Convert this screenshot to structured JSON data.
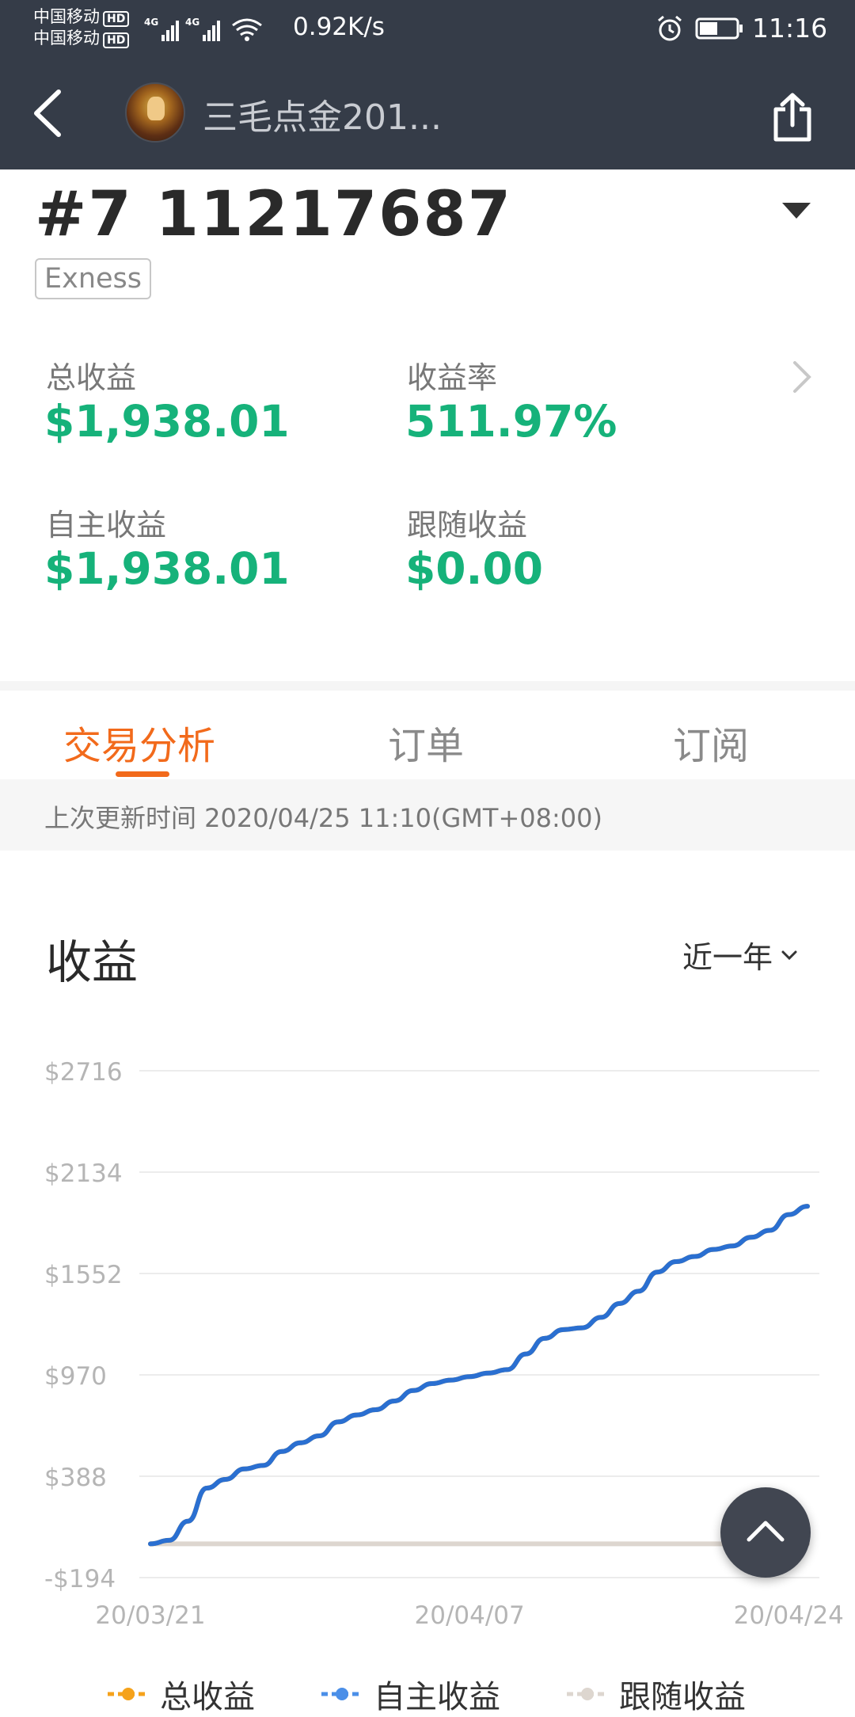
{
  "status_bar": {
    "carrier_1": "中国移动",
    "carrier_2": "中国移动",
    "hd_badge": "HD",
    "net_type": "4G",
    "speed": "0.92K/s",
    "time": "11:16"
  },
  "header": {
    "title": "三毛点金201..."
  },
  "account": {
    "id": "#7 11217687",
    "broker": "Exness"
  },
  "stats": {
    "total_label": "总收益",
    "total_value": "$1,938.01",
    "rate_label": "收益率",
    "rate_value": "511.97%",
    "own_label": "自主收益",
    "own_value": "$1,938.01",
    "follow_label": "跟随收益",
    "follow_value": "$0.00"
  },
  "tabs": [
    {
      "label": "交易分析",
      "active": true
    },
    {
      "label": "订单",
      "active": false
    },
    {
      "label": "订阅",
      "active": false
    }
  ],
  "update_text": "上次更新时间 2020/04/25 11:10(GMT+08:00)",
  "section": {
    "title": "收益",
    "period": "近一年"
  },
  "colors": {
    "accent": "#f26a1b",
    "profit_green": "#16b27a",
    "series_own": "#2a6fd1",
    "series_follow": "#ddd6cf",
    "series_total": "#f5a21b"
  },
  "chart_data": {
    "type": "line",
    "y_ticks": [
      "$2716",
      "$2134",
      "$1552",
      "$970",
      "$388",
      "-$194"
    ],
    "y_tick_values": [
      2716,
      2134,
      1552,
      970,
      388,
      -194
    ],
    "ylim": [
      -194,
      2716
    ],
    "x_ticks": [
      "20/03/21",
      "20/04/07",
      "20/04/24"
    ],
    "x": [
      "2020-03-21",
      "2020-03-22",
      "2020-03-23",
      "2020-03-24",
      "2020-03-25",
      "2020-03-26",
      "2020-03-27",
      "2020-03-28",
      "2020-03-29",
      "2020-03-30",
      "2020-03-31",
      "2020-04-01",
      "2020-04-02",
      "2020-04-03",
      "2020-04-04",
      "2020-04-05",
      "2020-04-06",
      "2020-04-07",
      "2020-04-08",
      "2020-04-09",
      "2020-04-10",
      "2020-04-11",
      "2020-04-12",
      "2020-04-13",
      "2020-04-14",
      "2020-04-15",
      "2020-04-16",
      "2020-04-17",
      "2020-04-18",
      "2020-04-19",
      "2020-04-20",
      "2020-04-21",
      "2020-04-22",
      "2020-04-23",
      "2020-04-24",
      "2020-04-25"
    ],
    "series": [
      {
        "name": "总收益",
        "values": [
          0,
          20,
          130,
          320,
          370,
          430,
          450,
          530,
          580,
          620,
          700,
          740,
          770,
          820,
          880,
          920,
          940,
          960,
          980,
          1000,
          1090,
          1180,
          1230,
          1240,
          1300,
          1380,
          1450,
          1560,
          1620,
          1650,
          1690,
          1710,
          1760,
          1800,
          1890,
          1938
        ]
      },
      {
        "name": "自主收益",
        "values": [
          0,
          20,
          130,
          320,
          370,
          430,
          450,
          530,
          580,
          620,
          700,
          740,
          770,
          820,
          880,
          920,
          940,
          960,
          980,
          1000,
          1090,
          1180,
          1230,
          1240,
          1300,
          1380,
          1450,
          1560,
          1620,
          1650,
          1690,
          1710,
          1760,
          1800,
          1890,
          1938
        ]
      },
      {
        "name": "跟随收益",
        "values": [
          0,
          0,
          0,
          0,
          0,
          0,
          0,
          0,
          0,
          0,
          0,
          0,
          0,
          0,
          0,
          0,
          0,
          0,
          0,
          0,
          0,
          0,
          0,
          0,
          0,
          0,
          0,
          0,
          0,
          0,
          0,
          0,
          0,
          0,
          0,
          0
        ]
      }
    ],
    "legend": [
      "总收益",
      "自主收益",
      "跟随收益"
    ],
    "grid": true,
    "legend_position": "bottom"
  }
}
